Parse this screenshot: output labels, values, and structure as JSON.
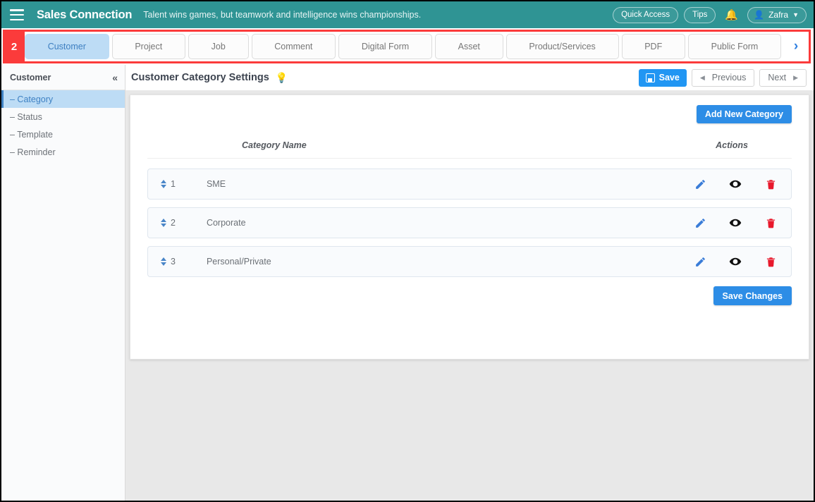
{
  "header": {
    "menu_icon": "hamburger-icon",
    "brand": "Sales Connection",
    "tagline": "Talent wins games, but teamwork and intelligence wins championships.",
    "quick_access_label": "Quick Access",
    "tips_label": "Tips",
    "bell_icon": "bell-icon",
    "user_name": "Zafra",
    "user_caret": "⌄"
  },
  "nav": {
    "badge": "2",
    "next_icon": "›",
    "tabs": [
      {
        "label": "Customer",
        "active": true
      },
      {
        "label": "Project",
        "active": false
      },
      {
        "label": "Job",
        "active": false
      },
      {
        "label": "Comment",
        "active": false
      },
      {
        "label": "Digital Form",
        "active": false
      },
      {
        "label": "Asset",
        "active": false
      },
      {
        "label": "Product/Services",
        "active": false
      },
      {
        "label": "PDF",
        "active": false
      },
      {
        "label": "Public Form",
        "active": false
      }
    ]
  },
  "subheader": {
    "title": "Customer Category Settings",
    "hint_icon": "lightbulb-icon",
    "save_label": "Save",
    "previous_label": "Previous",
    "next_label": "Next",
    "prev_arrow": "◀",
    "next_arrow": "▶"
  },
  "sidebar": {
    "title": "Customer",
    "collapse_icon": "«",
    "items": [
      {
        "label": "– Category",
        "active": true
      },
      {
        "label": "– Status",
        "active": false
      },
      {
        "label": "– Template",
        "active": false
      },
      {
        "label": "– Reminder",
        "active": false
      }
    ]
  },
  "main": {
    "add_button_label": "Add New Category",
    "columns": {
      "name": "Category Name",
      "actions": "Actions"
    },
    "rows": [
      {
        "order": "1",
        "name": "SME"
      },
      {
        "order": "2",
        "name": "Corporate"
      },
      {
        "order": "3",
        "name": "Personal/Private"
      }
    ],
    "actions": {
      "edit_icon": "pencil-icon",
      "view_icon": "eye-icon",
      "delete_icon": "trash-icon"
    },
    "save_changes_label": "Save Changes"
  },
  "colors": {
    "brand_teal": "#2f9494",
    "accent_blue": "#2d8de6",
    "active_tab_blue": "#bddcf5",
    "annotation_red": "#fb3b3b",
    "delete_red": "#e8192c",
    "edit_blue": "#3b7dd8"
  }
}
